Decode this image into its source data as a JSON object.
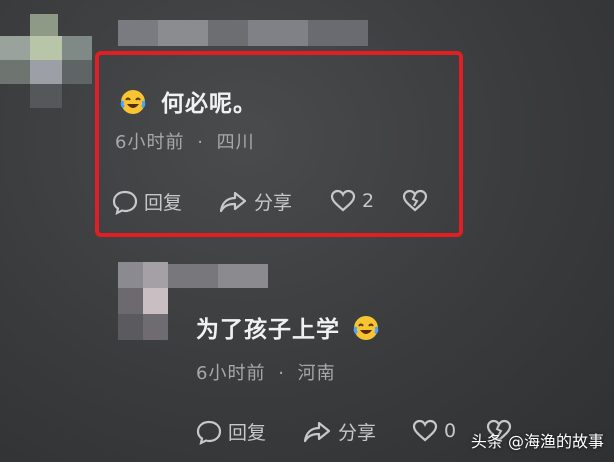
{
  "comments": [
    {
      "text": "何必呢。",
      "time": "6小时前",
      "separator": "·",
      "location": "四川",
      "reply_label": "回复",
      "share_label": "分享",
      "like_count": "2",
      "emoji": "laughing-crying-emoji"
    },
    {
      "text": "为了孩子上学",
      "time": "6小时前",
      "separator": "·",
      "location": "河南",
      "reply_label": "回复",
      "share_label": "分享",
      "like_count": "0",
      "emoji": "laughing-crying-emoji"
    }
  ],
  "watermark": {
    "text": "头条 @海渔的故事"
  },
  "colors": {
    "highlight": "#e11e24",
    "background": "#3a3b3d"
  }
}
